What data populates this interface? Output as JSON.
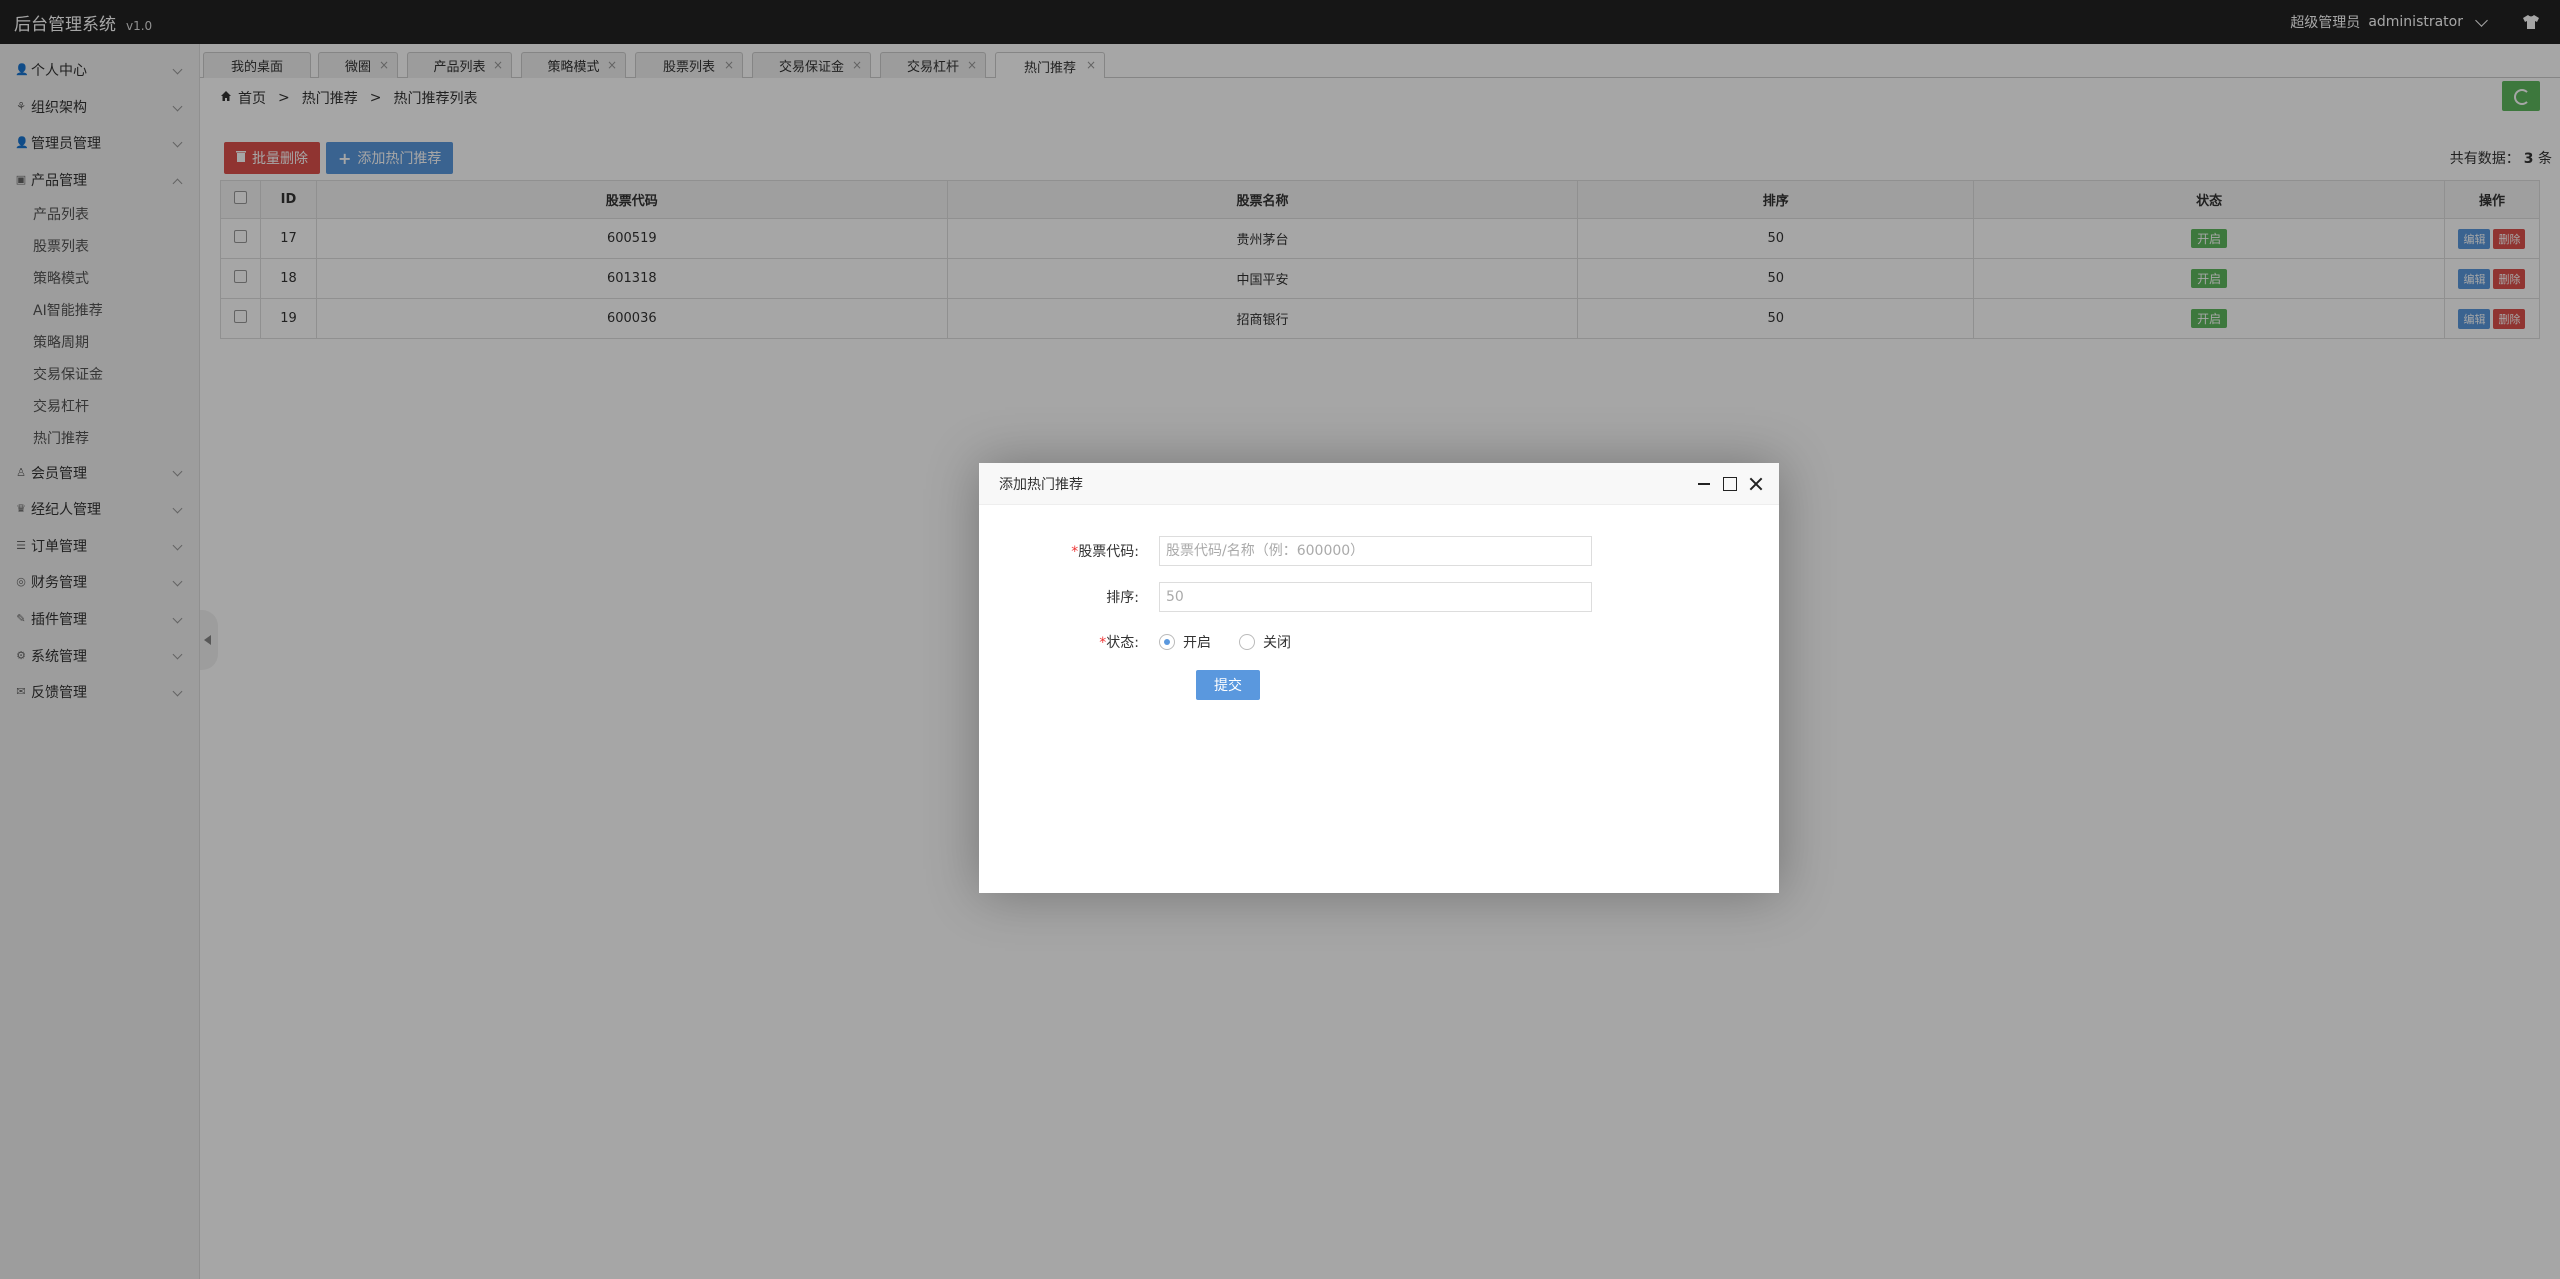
{
  "header": {
    "title": "后台管理系统",
    "version": "v1.0",
    "role": "超级管理员",
    "username": "administrator"
  },
  "sidebar": {
    "items": [
      {
        "label": "个人中心",
        "icon": "user-icon",
        "expanded": false
      },
      {
        "label": "组织架构",
        "icon": "org-icon",
        "expanded": false
      },
      {
        "label": "管理员管理",
        "icon": "admin-icon",
        "expanded": false
      },
      {
        "label": "产品管理",
        "icon": "product-icon",
        "expanded": true,
        "children": [
          "产品列表",
          "股票列表",
          "策略模式",
          "AI智能推荐",
          "策略周期",
          "交易保证金",
          "交易杠杆",
          "热门推荐"
        ]
      },
      {
        "label": "会员管理",
        "icon": "member-icon",
        "expanded": false
      },
      {
        "label": "经纪人管理",
        "icon": "broker-icon",
        "expanded": false
      },
      {
        "label": "订单管理",
        "icon": "order-icon",
        "expanded": false
      },
      {
        "label": "财务管理",
        "icon": "finance-icon",
        "expanded": false
      },
      {
        "label": "插件管理",
        "icon": "plugin-icon",
        "expanded": false
      },
      {
        "label": "系统管理",
        "icon": "system-icon",
        "expanded": false
      },
      {
        "label": "反馈管理",
        "icon": "feedback-icon",
        "expanded": false
      }
    ]
  },
  "tabs": [
    "我的桌面",
    "微圈",
    "产品列表",
    "策略模式",
    "股票列表",
    "交易保证金",
    "交易杠杆",
    "热门推荐"
  ],
  "breadcrumb": {
    "home": "首页",
    "level1": "热门推荐",
    "level2": "热门推荐列表",
    "sep": ">"
  },
  "toolbar": {
    "batch_delete": "批量删除",
    "add": "添加热门推荐"
  },
  "total": {
    "prefix": "共有数据：",
    "count": "3",
    "suffix": "条"
  },
  "table": {
    "headers": [
      "ID",
      "股票代码",
      "股票名称",
      "排序",
      "状态",
      "操作"
    ],
    "rows": [
      {
        "id": "17",
        "code": "600519",
        "name": "贵州茅台",
        "sort": "50",
        "status": "开启",
        "edit": "编辑",
        "delete": "删除"
      },
      {
        "id": "18",
        "code": "601318",
        "name": "中国平安",
        "sort": "50",
        "status": "开启",
        "edit": "编辑",
        "delete": "删除"
      },
      {
        "id": "19",
        "code": "600036",
        "name": "招商银行",
        "sort": "50",
        "status": "开启",
        "edit": "编辑",
        "delete": "删除"
      }
    ]
  },
  "dialog": {
    "title": "添加热门推荐",
    "code_label": "股票代码:",
    "code_placeholder": "股票代码/名称（例：600000）",
    "sort_label": "排序:",
    "sort_placeholder": "50",
    "status_label": "状态:",
    "status_on": "开启",
    "status_off": "关闭",
    "submit": "提交",
    "required_mark": "*"
  },
  "colors": {
    "accent": "#5a98de",
    "danger": "#dd514c",
    "success": "#5eb95e",
    "header_bg": "#222222"
  }
}
